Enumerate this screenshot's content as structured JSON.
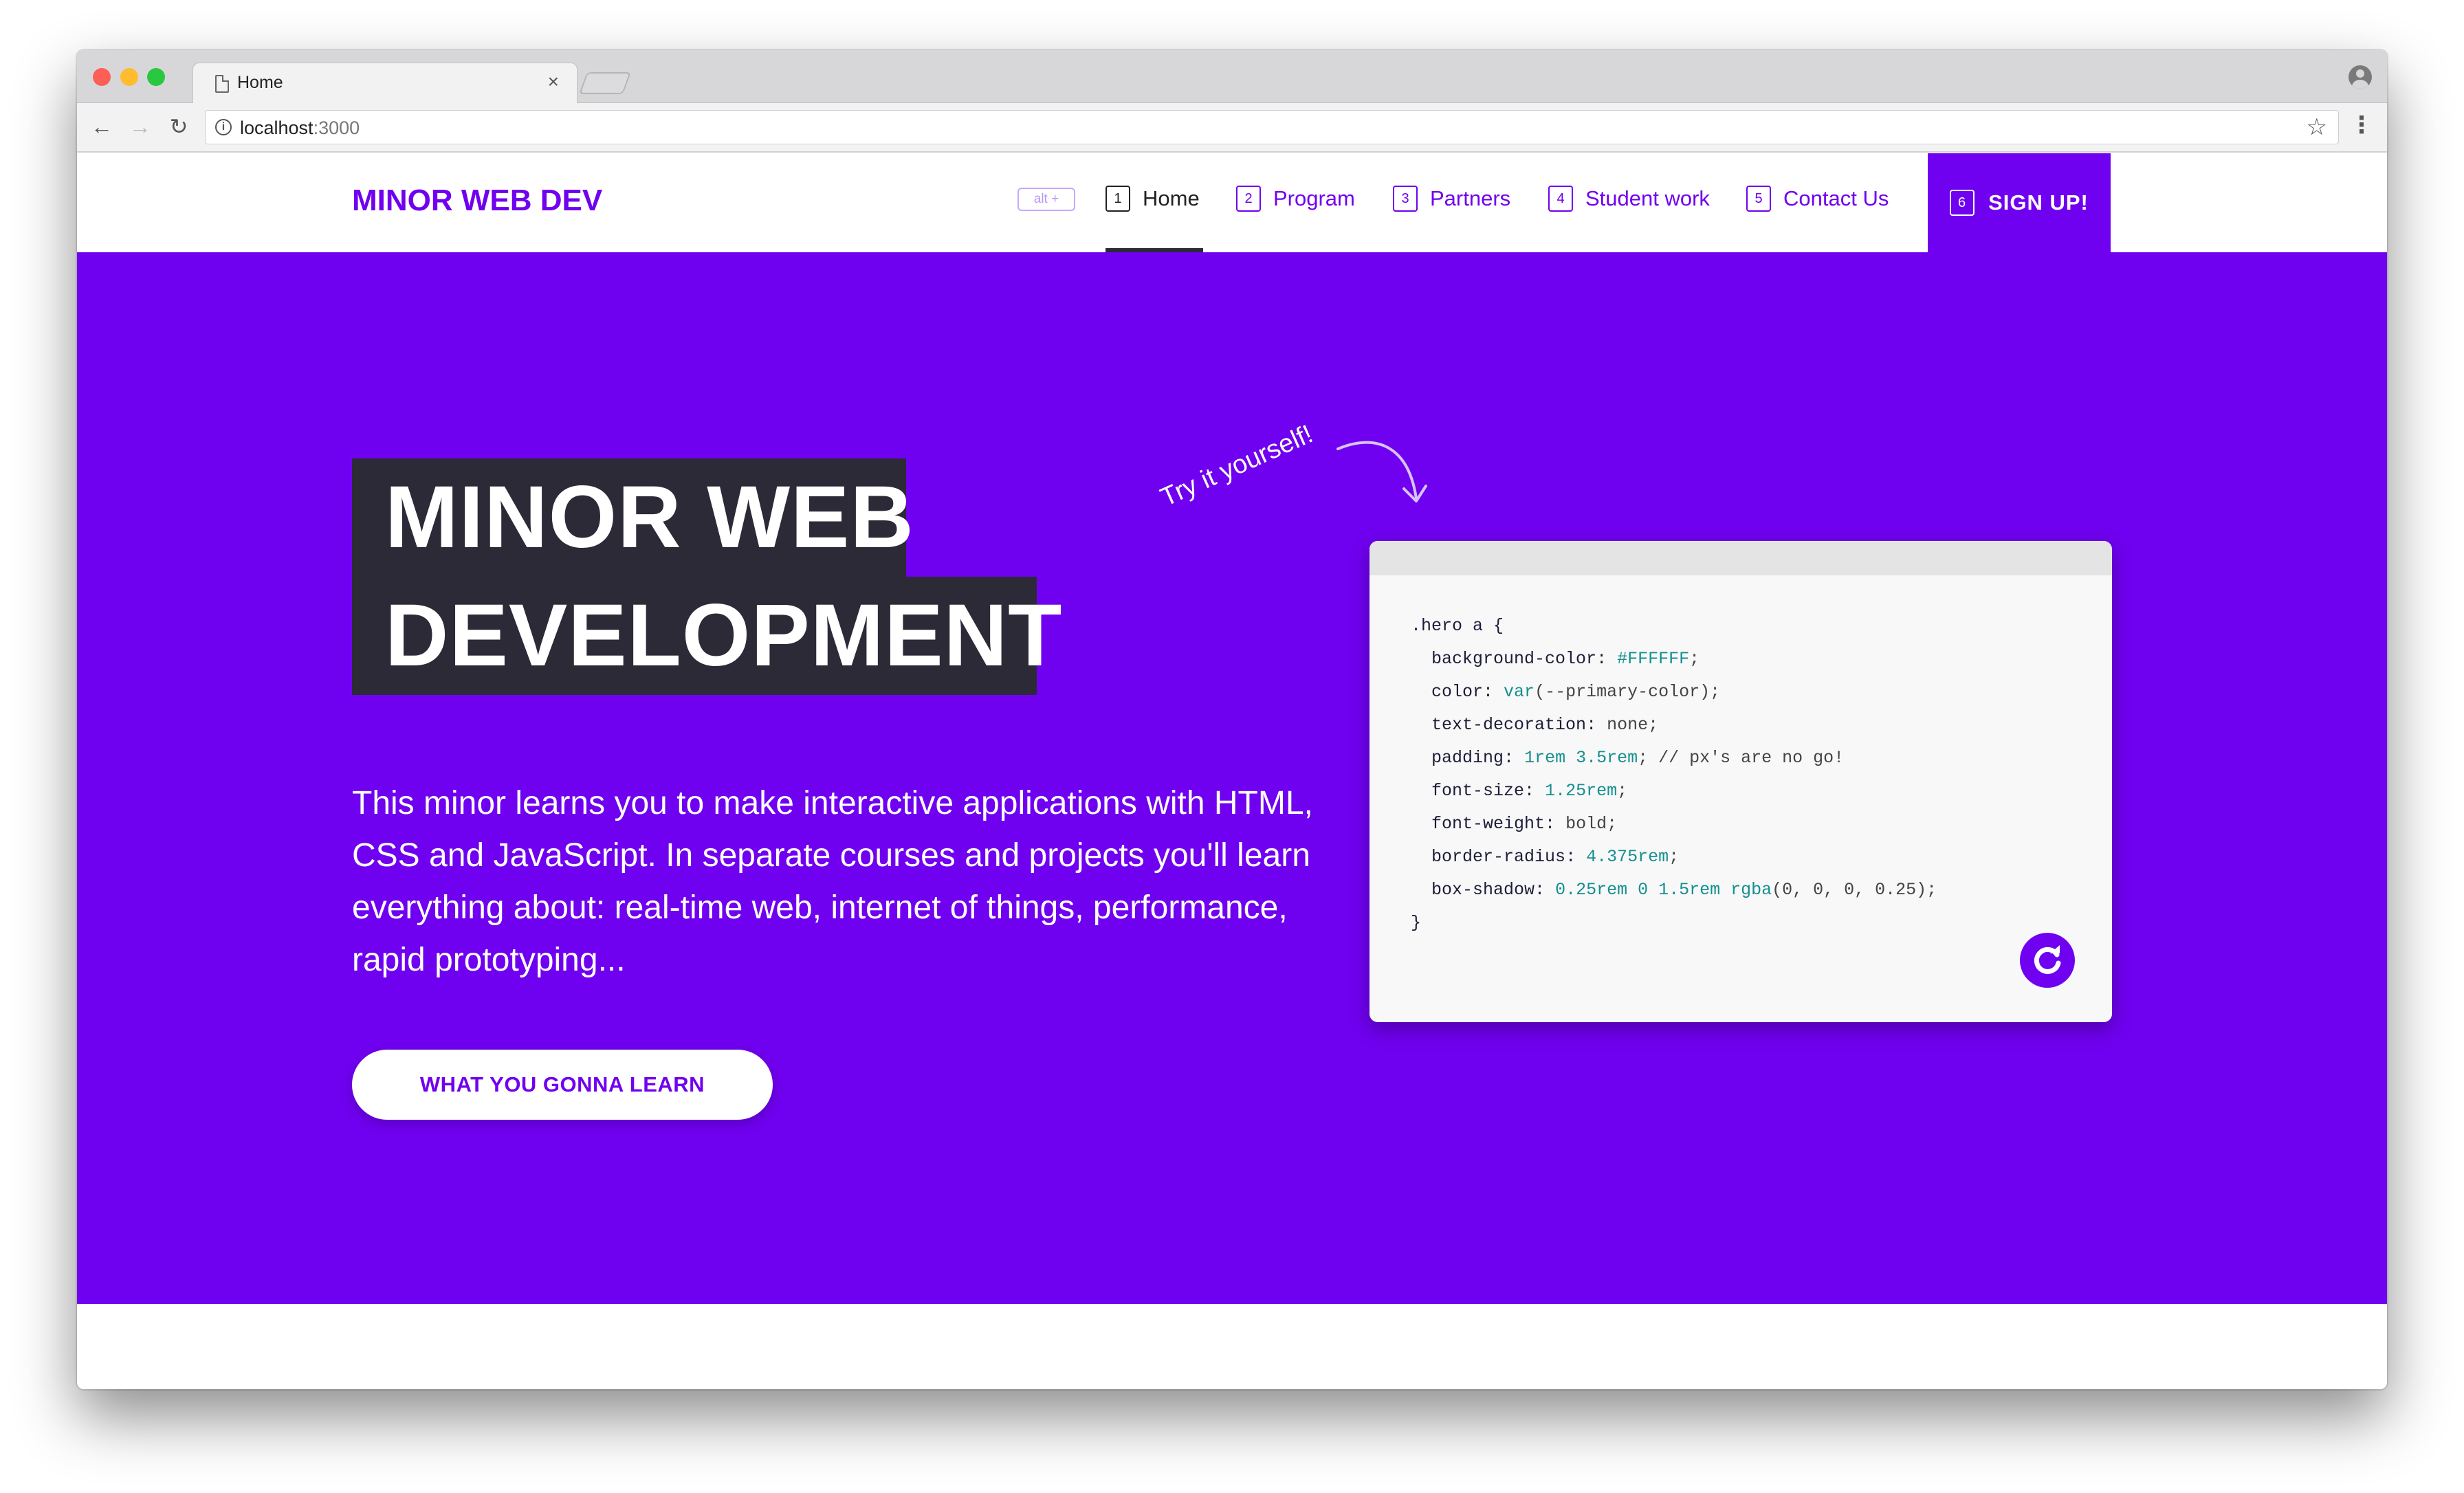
{
  "browser": {
    "tab_title": "Home",
    "tab_close": "×",
    "url_host": "localhost",
    "url_port": ":3000",
    "back": "←",
    "forward": "→",
    "reload": "↻",
    "info": "i",
    "star": "☆",
    "menu": "⋮"
  },
  "header": {
    "logo": "MINOR WEB DEV",
    "alt_hint": "alt +",
    "nav": [
      {
        "key": "1",
        "label": "Home",
        "active": true
      },
      {
        "key": "2",
        "label": "Program"
      },
      {
        "key": "3",
        "label": "Partners"
      },
      {
        "key": "4",
        "label": "Student work"
      },
      {
        "key": "5",
        "label": "Contact Us"
      }
    ],
    "signup": {
      "key": "6",
      "label": "SIGN UP!"
    }
  },
  "hero": {
    "title_line1": "MINOR WEB",
    "title_line2": "DEVELOPMENT",
    "description": "This minor learns you to make interactive applications with HTML, CSS and JavaScript. In separate courses and projects you'll learn everything about: real-time web, internet of things, performance, rapid prototyping...",
    "cta": "WHAT YOU GONNA LEARN",
    "try_label": "Try it yourself!",
    "code": {
      "selector": ".hero a {",
      "lines": [
        {
          "prop": "background-color",
          "val": "#FFFFFF",
          "rest": ";"
        },
        {
          "prop": "color",
          "val": "var",
          "rest": "(--primary-color);"
        },
        {
          "prop": "text-decoration",
          "val": "",
          "rest": " none;"
        },
        {
          "prop": "padding",
          "val": "1rem 3.5rem",
          "rest": "; // px's are no go!"
        },
        {
          "prop": "font-size",
          "val": "1.25rem",
          "rest": ";"
        },
        {
          "prop": "font-weight",
          "val": "",
          "rest": " bold;"
        },
        {
          "prop": "border-radius",
          "val": "4.375rem",
          "rest": ";"
        },
        {
          "prop": "box-shadow",
          "val": "0.25rem 0 1.5rem rgba",
          "rest": "(0, 0, 0, 0.25);"
        }
      ],
      "closing": "}"
    }
  },
  "colors": {
    "primary": "#7000f0",
    "dark": "#2b2a36",
    "code_value": "#158f8f"
  }
}
